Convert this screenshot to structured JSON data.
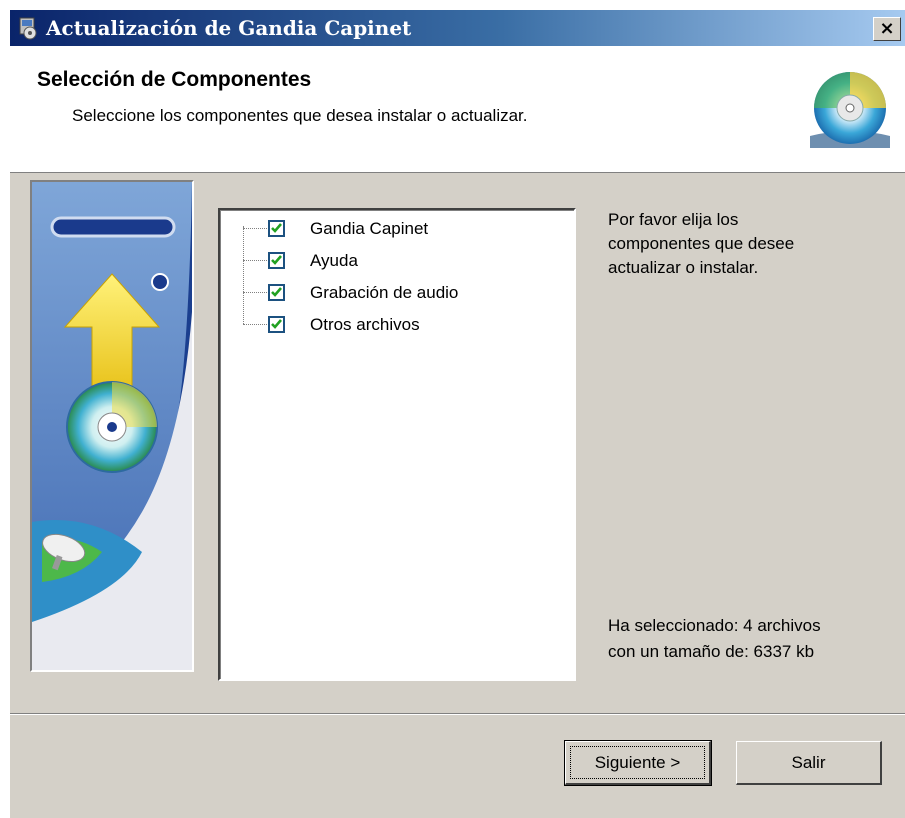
{
  "window": {
    "title": "Actualización de Gandia Capinet",
    "close_label": "×"
  },
  "header": {
    "title": "Selección de Componentes",
    "subtitle": "Seleccione los componentes que desea instalar o actualizar."
  },
  "components": [
    {
      "label": "Gandia Capinet",
      "checked": true
    },
    {
      "label": "Ayuda",
      "checked": true
    },
    {
      "label": "Grabación de audio",
      "checked": true
    },
    {
      "label": "Otros archivos",
      "checked": true
    }
  ],
  "info": {
    "line1": "Por favor elija los",
    "line2": "componentes que desee",
    "line3": "actualizar o instalar."
  },
  "status": {
    "line1": "Ha seleccionado: 4 archivos",
    "line2": "con un tamaño de: 6337 kb"
  },
  "buttons": {
    "next_label": "Siguiente >",
    "exit_label": "Salir"
  },
  "colors": {
    "titlebar_start": "#0a246a",
    "dialog_bg": "#d4d0c8",
    "check_green": "#21a121"
  }
}
